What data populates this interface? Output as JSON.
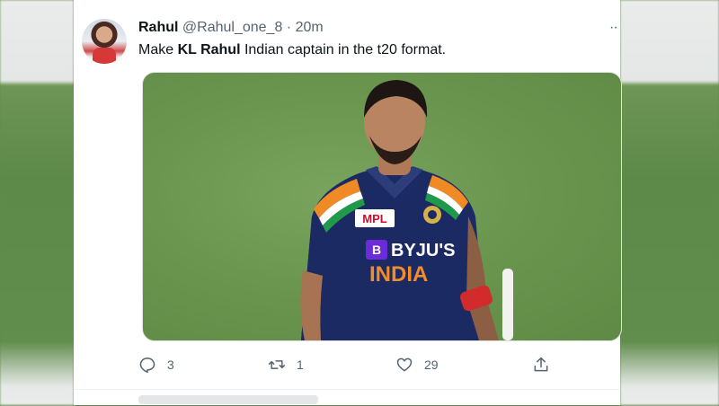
{
  "tweet": {
    "author_name": "Rahul",
    "author_handle": "@Rahul_one_8",
    "separator": "·",
    "time": "20m",
    "more_label": "··",
    "text_before": "Make ",
    "text_bold": "KL Rahul",
    "text_after": " Indian captain in the t20 format.",
    "media": {
      "jersey_sponsor": "MPL",
      "jersey_brand": "BYJU'S",
      "jersey_country": "INDIA"
    },
    "actions": {
      "reply_icon": "reply-icon",
      "reply_count": "3",
      "retweet_icon": "retweet-icon",
      "retweet_count": "1",
      "like_icon": "heart-icon",
      "like_count": "29",
      "share_icon": "share-icon"
    }
  },
  "colors": {
    "text": "#0f1419",
    "secondary": "#536471",
    "jersey": "#1c2a63",
    "pitch": "#6a9650"
  }
}
